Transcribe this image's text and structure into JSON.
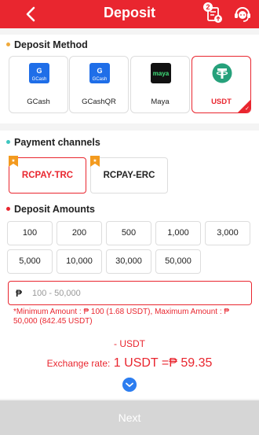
{
  "header": {
    "title": "Deposit",
    "badge_count": "2",
    "icons": [
      "back-arrow-icon",
      "records-icon",
      "customer-service-icon"
    ],
    "color": "#e9262f"
  },
  "deposit_method": {
    "title": "Deposit Method",
    "dot_color": "#f0a93b",
    "items": [
      {
        "label": "GCash",
        "logo_text": "GCash",
        "selected": false
      },
      {
        "label": "GCashQR",
        "logo_text": "GCash",
        "selected": false
      },
      {
        "label": "Maya",
        "logo_text": "maya",
        "selected": false
      },
      {
        "label": "USDT",
        "logo_text": "₮",
        "selected": true
      }
    ]
  },
  "payment_channels": {
    "title": "Payment channels",
    "dot_color": "#3ec6c0",
    "items": [
      {
        "label": "RCPAY-TRC",
        "selected": true
      },
      {
        "label": "RCPAY-ERC",
        "selected": false
      }
    ]
  },
  "deposit_amounts": {
    "title": "Deposit Amounts",
    "dot_color": "#e9262f",
    "row1": [
      "100",
      "200",
      "500",
      "1,000",
      "3,000"
    ],
    "row2": [
      "5,000",
      "10,000",
      "30,000",
      "50,000"
    ],
    "input": {
      "currency_symbol": "₱",
      "placeholder": "100 - 50,000"
    },
    "note": "*Minimum Amount : ₱ 100 (1.68 USDT),   Maximum Amount : ₱ 50,000 (842.45 USDT)",
    "usdt_line": "- USDT",
    "rate_label": "Exchange rate:",
    "rate_value": " 1 USDT =₱ 59.35"
  },
  "footer": {
    "next_label": "Next"
  }
}
